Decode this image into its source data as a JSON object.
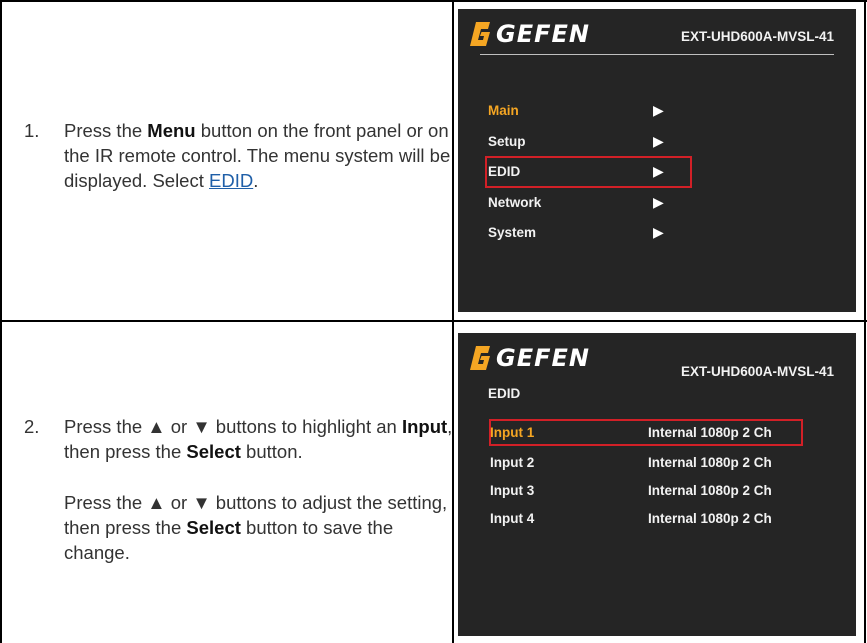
{
  "steps": [
    {
      "number": "1.",
      "pre_menu": "Press the ",
      "menu_bold": "Menu",
      "post_menu": " button on the front panel or on the IR remote control. The menu system will be displayed. Select ",
      "link": "EDID",
      "end": "."
    },
    {
      "number": "2.",
      "p1_a": "Press the ▲ or ▼ buttons to highlight an ",
      "p1_bold1": "Input",
      "p1_b": ", then press the ",
      "p1_bold2": "Select",
      "p1_c": " button.",
      "p2_a": "Press the ▲ or ▼ buttons to adjust the setting, then press the ",
      "p2_bold": "Select",
      "p2_b": " button to save the change."
    }
  ],
  "screen1": {
    "logo": "GEFEN",
    "model": "EXT-UHD600A-MVSL-41",
    "items": [
      {
        "label": "Main",
        "arrow": "▶"
      },
      {
        "label": "Setup",
        "arrow": "▶"
      },
      {
        "label": "EDID",
        "arrow": "▶"
      },
      {
        "label": "Network",
        "arrow": "▶"
      },
      {
        "label": "System",
        "arrow": "▶"
      }
    ]
  },
  "screen2": {
    "logo": "GEFEN",
    "model": "EXT-UHD600A-MVSL-41",
    "title": "EDID",
    "rows": [
      {
        "input": "Input 1",
        "value": "Internal 1080p 2 Ch"
      },
      {
        "input": "Input 2",
        "value": "Internal 1080p 2 Ch"
      },
      {
        "input": "Input 3",
        "value": "Internal 1080p 2 Ch"
      },
      {
        "input": "Input 4",
        "value": "Internal 1080p 2 Ch"
      }
    ]
  },
  "colors": {
    "screen_bg": "#252525",
    "highlight_text": "#f5a623",
    "highlight_box": "#d22027",
    "link": "#1f5fa8",
    "logo_mark": "#f5a623"
  }
}
